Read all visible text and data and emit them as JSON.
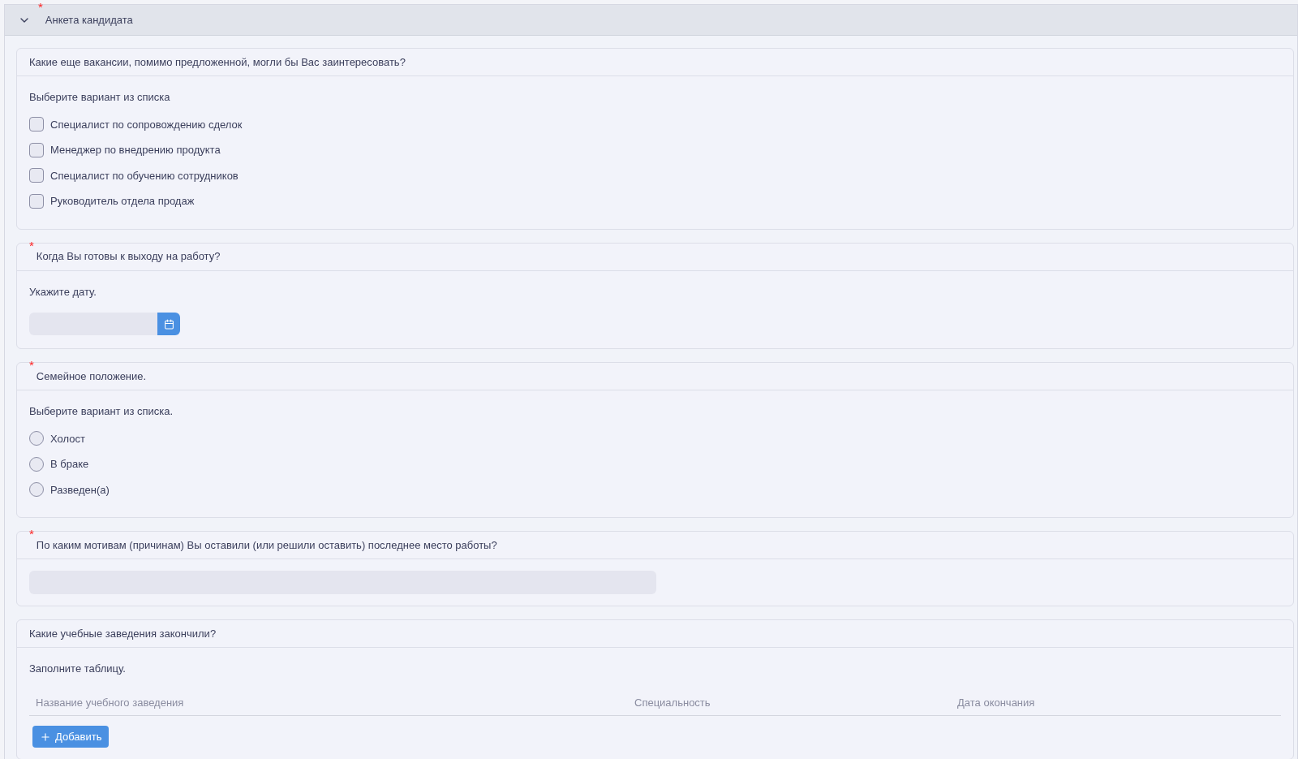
{
  "section": {
    "title": "Анкета кандидата",
    "required_mark": "*",
    "expanded": true
  },
  "questions": [
    {
      "kind": "checkbox",
      "title": "Какие еще вакансии, помимо предложенной, могли бы Вас заинтересовать?",
      "hint": "Выберите вариант из списка",
      "options": [
        {
          "label": "Специалист по сопровождению сделок",
          "checked": false
        },
        {
          "label": "Менеджер по внедрению продукта",
          "checked": false
        },
        {
          "label": "Специалист по обучению сотрудников",
          "checked": false
        },
        {
          "label": "Руководитель отдела продаж",
          "checked": false
        }
      ]
    },
    {
      "kind": "date",
      "title": "Когда Вы готовы к выходу на работу?",
      "required_mark": "*",
      "hint": "Укажите дату."
    },
    {
      "kind": "radio",
      "title": "Семейное положение.",
      "required_mark": "*",
      "hint": "Выберите вариант из списка.",
      "options": [
        {
          "label": "Холост",
          "selected": false
        },
        {
          "label": "В браке",
          "selected": false
        },
        {
          "label": "Разведен(а)",
          "selected": false
        }
      ]
    },
    {
      "kind": "text",
      "title": "По каким мотивам (причинам) Вы оставили (или решили оставить) последнее место работы?",
      "required_mark": "*"
    },
    {
      "kind": "table",
      "title": "Какие учебные заведения закончили?",
      "hint": "Заполните таблицу.",
      "columns": [
        "Название учебного заведения",
        "Специальность",
        "Дата окончания"
      ],
      "add_button": "Добавить"
    }
  ]
}
